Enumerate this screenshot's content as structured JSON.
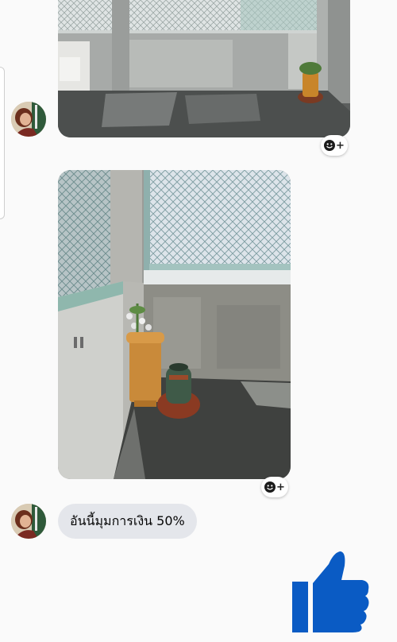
{
  "chat": {
    "messages": [
      {
        "type": "image",
        "sender": "other",
        "subject": "rooftop-balcony-wide"
      },
      {
        "type": "image",
        "sender": "other",
        "subject": "rooftop-balcony-corner-plants"
      },
      {
        "type": "text",
        "sender": "other",
        "text": "อันนี้มุมการเงิน 50%"
      }
    ],
    "reaction_button": {
      "icon": "smiley-add-icon",
      "label": "+"
    }
  },
  "composer": {
    "like_icon": "thumbs-up-icon"
  },
  "colors": {
    "like": "#0a5bc4",
    "bubble": "#e4e6eb",
    "background": "#fafafa"
  }
}
